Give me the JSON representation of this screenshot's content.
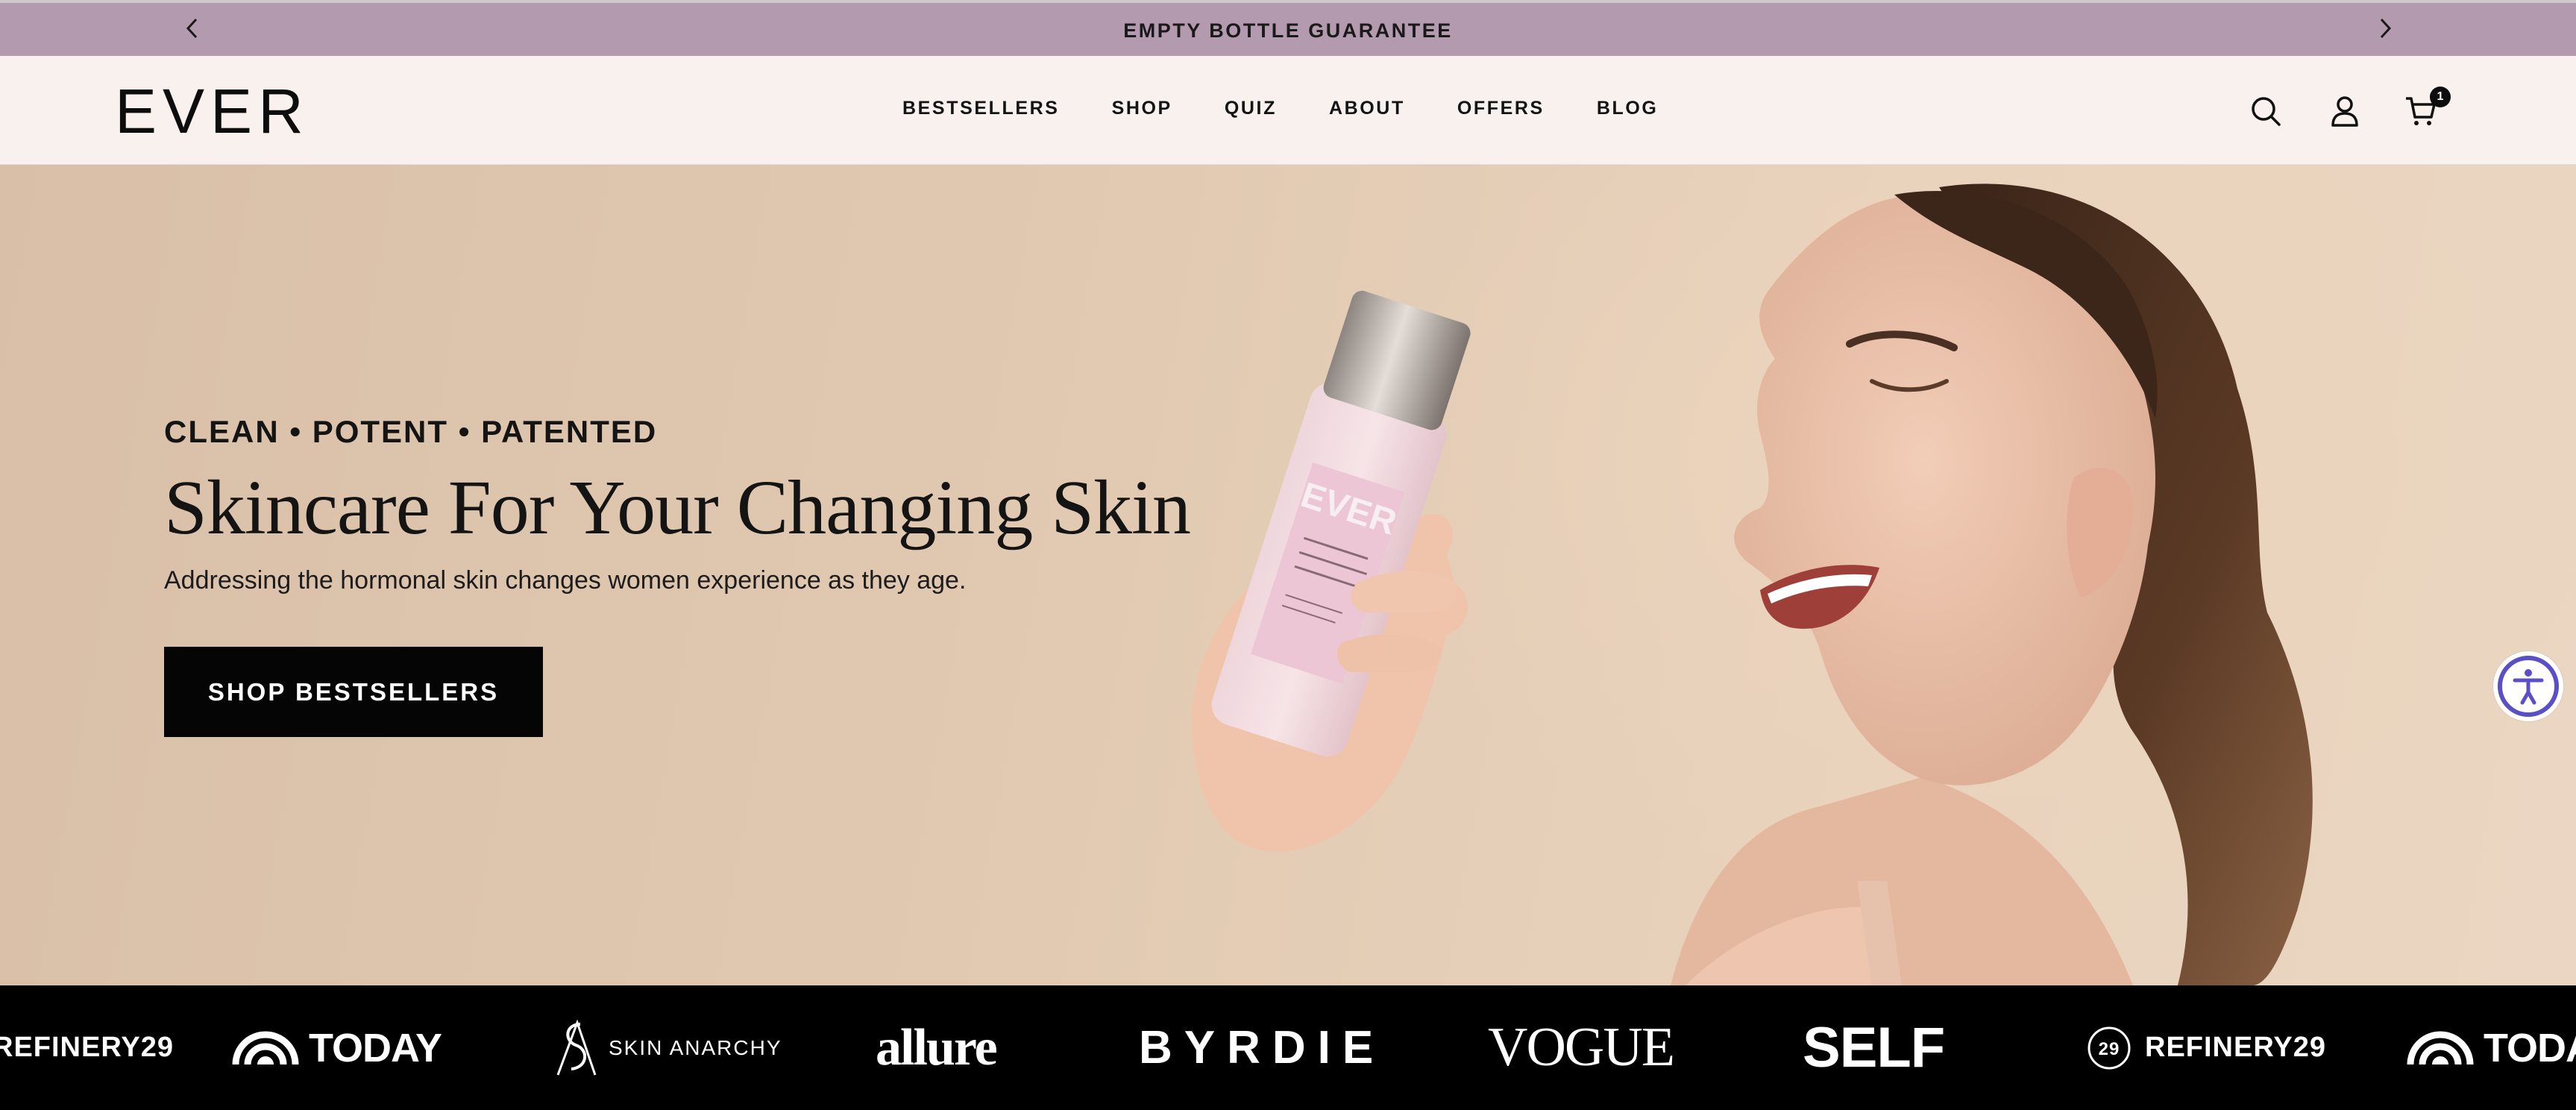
{
  "announcement": {
    "message": "EMPTY BOTTLE GUARANTEE",
    "prev_icon": "chevron-left-icon",
    "next_icon": "chevron-right-icon"
  },
  "header": {
    "logo": "EVER",
    "nav": [
      "BESTSELLERS",
      "SHOP",
      "QUIZ",
      "ABOUT",
      "OFFERS",
      "BLOG"
    ],
    "icons": [
      "search-icon",
      "account-icon",
      "cart-icon"
    ],
    "cart_count": "1"
  },
  "hero": {
    "tagline": "CLEAN • POTENT • PATENTED",
    "headline": "Skincare For Your Changing Skin",
    "subtext": "Addressing the hormonal skin changes women experience as they age.",
    "cta": "SHOP BESTSELLERS",
    "bottle_brand": "EVER"
  },
  "press": {
    "logos": [
      "REFINERY29",
      "TODAY",
      "SKIN ANARCHY",
      "allure",
      "BYRDIE",
      "VOGUE",
      "SELF",
      "REFINERY29",
      "TODAY"
    ]
  },
  "colors": {
    "announcement_bg": "#b49aae",
    "header_bg": "#f8f1ee",
    "cta_bg": "#050505",
    "press_bg": "#000000",
    "accessibility_accent": "#5a4fc6"
  }
}
